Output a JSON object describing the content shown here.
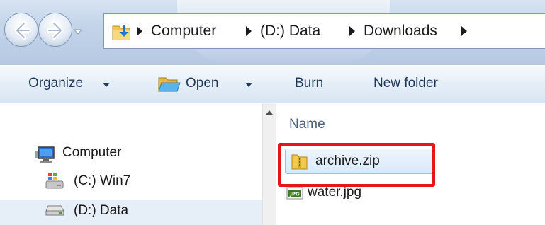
{
  "address_bar": {
    "breadcrumbs": [
      "Computer",
      "(D:) Data",
      "Downloads"
    ]
  },
  "toolbar": {
    "organize_label": "Organize",
    "open_label": "Open",
    "burn_label": "Burn",
    "new_folder_label": "New folder"
  },
  "nav_pane": {
    "items": [
      {
        "label": "Computer",
        "icon": "computer-icon"
      },
      {
        "label": "(C:) Win7",
        "icon": "windows-drive-icon"
      },
      {
        "label": "(D:) Data",
        "icon": "drive-icon"
      }
    ]
  },
  "file_list": {
    "column_header": "Name",
    "files": [
      {
        "name": "archive.zip",
        "icon": "zip-folder-icon",
        "selected": true
      },
      {
        "name": "water.jpg",
        "icon": "jpg-file-icon",
        "selected": false
      }
    ]
  },
  "annotation": {
    "color": "#e8141c"
  }
}
